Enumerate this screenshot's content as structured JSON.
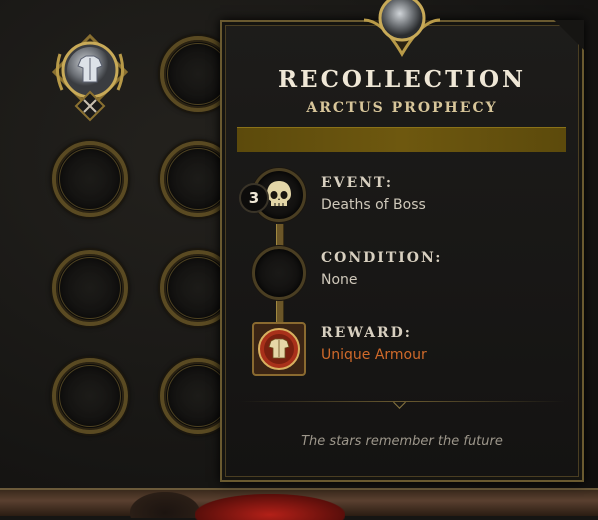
{
  "panel": {
    "title": "RECOLLECTION",
    "subtitle": "ARCTUS PROPHECY",
    "event": {
      "label": "EVENT:",
      "value": "Deaths of Boss",
      "count": "3",
      "icon": "skull-icon"
    },
    "condition": {
      "label": "CONDITION:",
      "value": "None"
    },
    "reward": {
      "label": "REWARD:",
      "value": "Unique Armour",
      "icon": "armour-icon"
    },
    "flavor_text": "The stars remember the future"
  },
  "colors": {
    "gold": "#6e580f",
    "unique": "#d06a2a",
    "text_light": "#efe7d6",
    "subtitle": "#d8c69a"
  },
  "grid": {
    "selected_slot_icon": "armour-icon",
    "selected_slot_marker": "close-icon"
  }
}
